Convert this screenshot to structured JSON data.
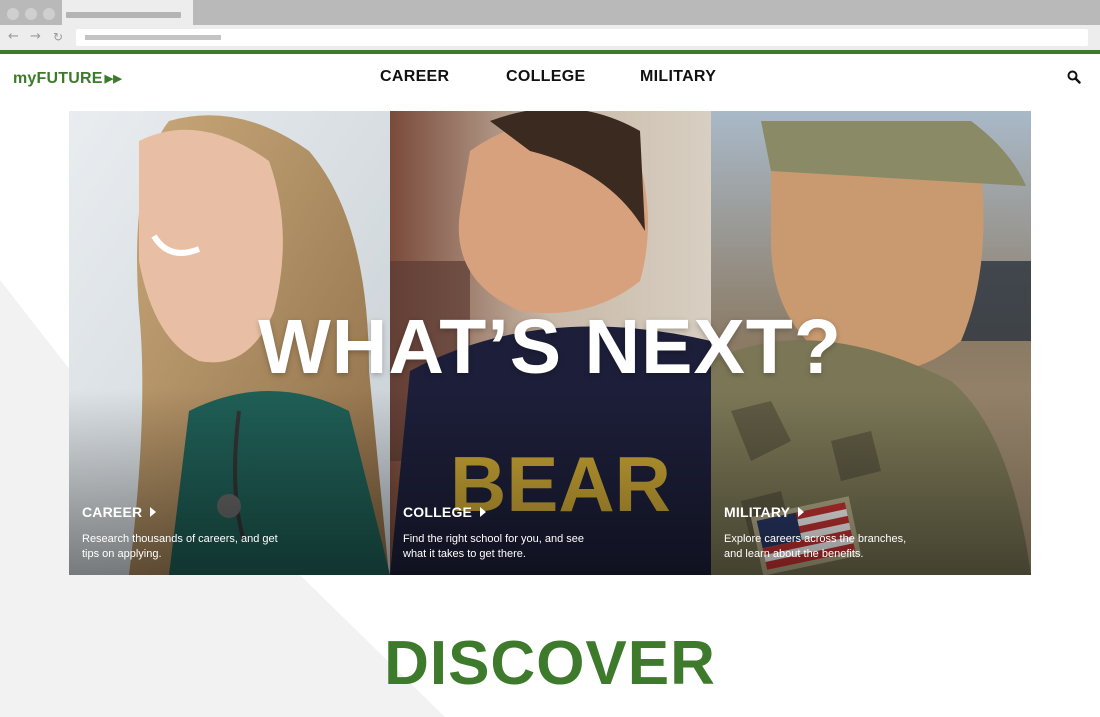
{
  "site": {
    "logo": "myFUTURE",
    "logo_icon": "double-chevron-right-icon"
  },
  "nav": {
    "items": [
      {
        "label": "CAREER"
      },
      {
        "label": "COLLEGE"
      },
      {
        "label": "MILITARY"
      }
    ],
    "search_icon": "search-icon"
  },
  "hero": {
    "title": "WHAT’S NEXT?",
    "panels": [
      {
        "label": "CAREER",
        "description": "Research thousands of careers, and get tips on applying."
      },
      {
        "label": "COLLEGE",
        "description": "Find the right school for you, and see what it takes to get there."
      },
      {
        "label": "MILITARY",
        "description": "Explore careers across the branches, and learn about the benefits."
      }
    ],
    "shirt_text": "BEAR"
  },
  "section": {
    "heading": "DISCOVER"
  },
  "colors": {
    "brand_green": "#3e7a2c",
    "nav_text": "#111111",
    "background": "#ffffff"
  }
}
